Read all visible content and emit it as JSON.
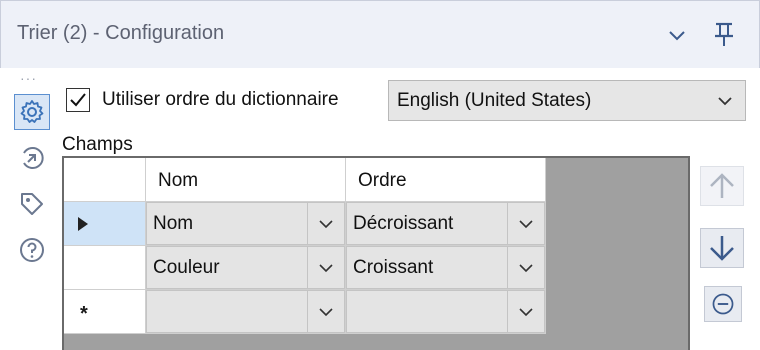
{
  "window": {
    "title": "Trier (2) - Configuration"
  },
  "options": {
    "dictionary_order_label": "Utiliser ordre du dictionnaire",
    "dictionary_order_checked": true,
    "language_select": "English (United States)"
  },
  "fields_section": {
    "label": "Champs"
  },
  "grid": {
    "columns": [
      "Nom",
      "Ordre"
    ],
    "rows": [
      {
        "field": "Nom",
        "order": "Décroissant",
        "selected": true
      },
      {
        "field": "Couleur",
        "order": "Croissant",
        "selected": false
      },
      {
        "field": "",
        "order": "",
        "selected": false
      }
    ],
    "new_row_marker": "*"
  },
  "icons": {
    "title_chevron": "chevron-down-icon",
    "pin": "pin-icon",
    "settings": "gear-icon",
    "connection": "connection-arrow-icon",
    "tag": "tag-icon",
    "help": "help-icon",
    "move_up": "arrow-up-icon",
    "move_down": "arrow-down-icon",
    "remove": "remove-circle-icon"
  },
  "colors": {
    "accent": "#3b73b9",
    "selected_row": "#cfe3f7",
    "grid_background": "#a0a0a0"
  }
}
